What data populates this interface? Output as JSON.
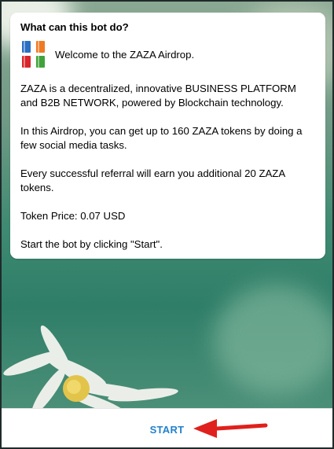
{
  "message": {
    "title": "What can this bot do?",
    "welcome": "Welcome to the ZAZA Airdrop.",
    "paragraphs": [
      "ZAZA is a decentralized, innovative BUSINESS PLATFORM and B2B NETWORK, powered by Blockchain technology.",
      "In this Airdrop, you can get up to 160 ZAZA tokens by doing a few social media tasks.",
      "Every successful referral will earn you additional 20 ZAZA tokens.",
      "Token Price: 0.07 USD",
      "Start the bot by clicking \"Start\"."
    ],
    "emoji_icon": "books-icon"
  },
  "footer": {
    "start_label": "START",
    "annotation_icon": "red-arrow-icon"
  },
  "colors": {
    "accent": "#2481cc",
    "arrow": "#e0201c",
    "background": "#3f8a72"
  }
}
